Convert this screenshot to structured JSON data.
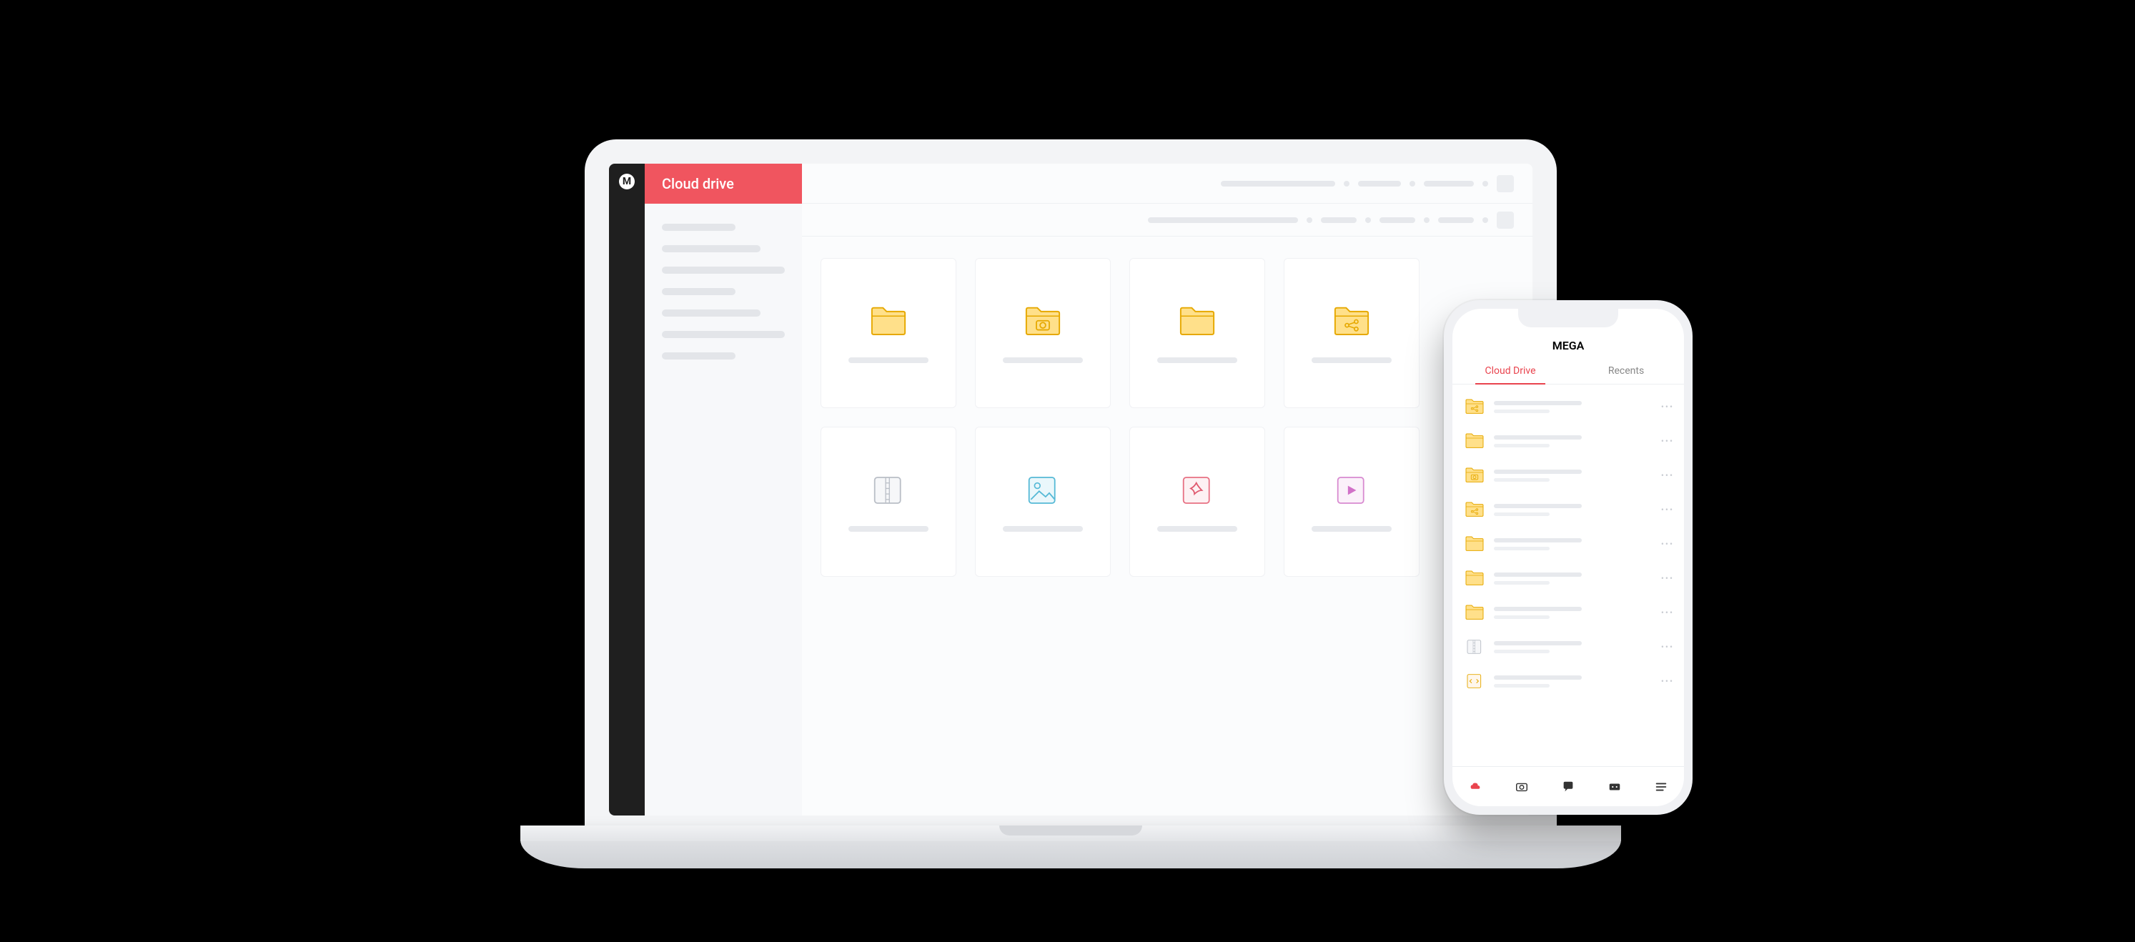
{
  "desktop": {
    "logo_glyph": "M",
    "title": "Cloud drive",
    "sidebar": {
      "items": [
        "",
        "",
        "",
        "",
        "",
        "",
        ""
      ]
    },
    "tiles": [
      {
        "type": "folder",
        "variant": "plain"
      },
      {
        "type": "folder",
        "variant": "camera"
      },
      {
        "type": "folder",
        "variant": "plain"
      },
      {
        "type": "folder",
        "variant": "share"
      },
      {
        "type": "file",
        "variant": "archive"
      },
      {
        "type": "file",
        "variant": "image"
      },
      {
        "type": "file",
        "variant": "pdf"
      },
      {
        "type": "file",
        "variant": "video"
      }
    ]
  },
  "mobile": {
    "app_title": "MEGA",
    "tabs": [
      {
        "label": "Cloud Drive",
        "active": true
      },
      {
        "label": "Recents",
        "active": false
      }
    ],
    "rows": [
      {
        "icon": "folder-share"
      },
      {
        "icon": "folder"
      },
      {
        "icon": "folder-camera"
      },
      {
        "icon": "folder-share"
      },
      {
        "icon": "folder"
      },
      {
        "icon": "folder"
      },
      {
        "icon": "folder"
      },
      {
        "icon": "file-archive"
      },
      {
        "icon": "file-code"
      }
    ],
    "more_glyph": "•••",
    "bottom_nav": [
      {
        "name": "cloud",
        "active": true
      },
      {
        "name": "camera",
        "active": false
      },
      {
        "name": "chat",
        "active": false
      },
      {
        "name": "shared",
        "active": false
      },
      {
        "name": "menu",
        "active": false
      }
    ]
  }
}
